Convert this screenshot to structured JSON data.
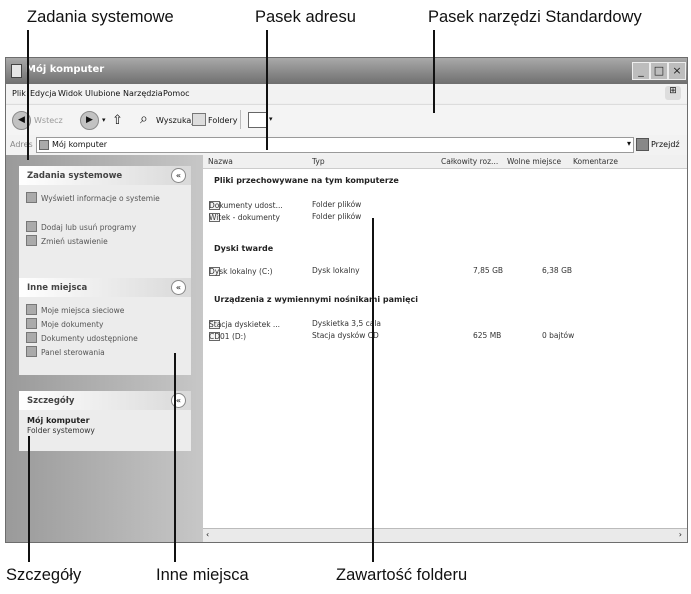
{
  "callouts": {
    "tasks": "Zadania systemowe",
    "address": "Pasek adresu",
    "toolbar": "Pasek narzędzi Standardowy",
    "details": "Szczegóły",
    "other": "Inne miejsca",
    "content": "Zawartość folderu"
  },
  "window": {
    "title": "Mój komputer",
    "controls": {
      "min": "_",
      "max": "□",
      "close": "×"
    }
  },
  "menu": [
    "Plik",
    "Edycja",
    "Widok",
    "Ulubione",
    "Narzędzia",
    "Pomoc"
  ],
  "toolbar": {
    "back": "Wstecz",
    "search": "Wyszukaj",
    "folders": "Foldery"
  },
  "address": {
    "label": "Adres",
    "value": "Mój komputer",
    "go": "Przejdź"
  },
  "tasks_panel": {
    "title": "Zadania systemowe",
    "items": [
      "Wyświetl informacje o systemie",
      "Dodaj lub usuń programy",
      "Zmień ustawienie"
    ]
  },
  "places_panel": {
    "title": "Inne miejsca",
    "items": [
      "Moje miejsca sieciowe",
      "Moje dokumenty",
      "Dokumenty udostępnione",
      "Panel sterowania"
    ]
  },
  "details_panel": {
    "title": "Szczegóły",
    "name": "Mój komputer",
    "type": "Folder systemowy"
  },
  "columns": [
    "Nazwa",
    "Typ",
    "Całkowity roz...",
    "Wolne miejsce",
    "Komentarze"
  ],
  "groups": {
    "stored": "Pliki przechowywane na tym komputerze",
    "hdd": "Dyski twarde",
    "removable": "Urządzenia z wymiennymi nośnikami pamięci"
  },
  "rows": {
    "shared_docs": {
      "name": "Dokumenty udost...",
      "type": "Folder plików"
    },
    "witek_docs": {
      "name": "Witek - dokumenty",
      "type": "Folder plików"
    },
    "local_disk": {
      "name": "Dysk lokalny (C:)",
      "type": "Dysk lokalny",
      "total": "7,85 GB",
      "free": "6,38 GB"
    },
    "floppy": {
      "name": "Stacja dyskietek ...",
      "type": "Dyskietka 3,5 cala"
    },
    "cd": {
      "name": "CD01 (D:)",
      "type": "Stacja dysków CD",
      "total": "625 MB",
      "free": "0 bajtów"
    }
  }
}
